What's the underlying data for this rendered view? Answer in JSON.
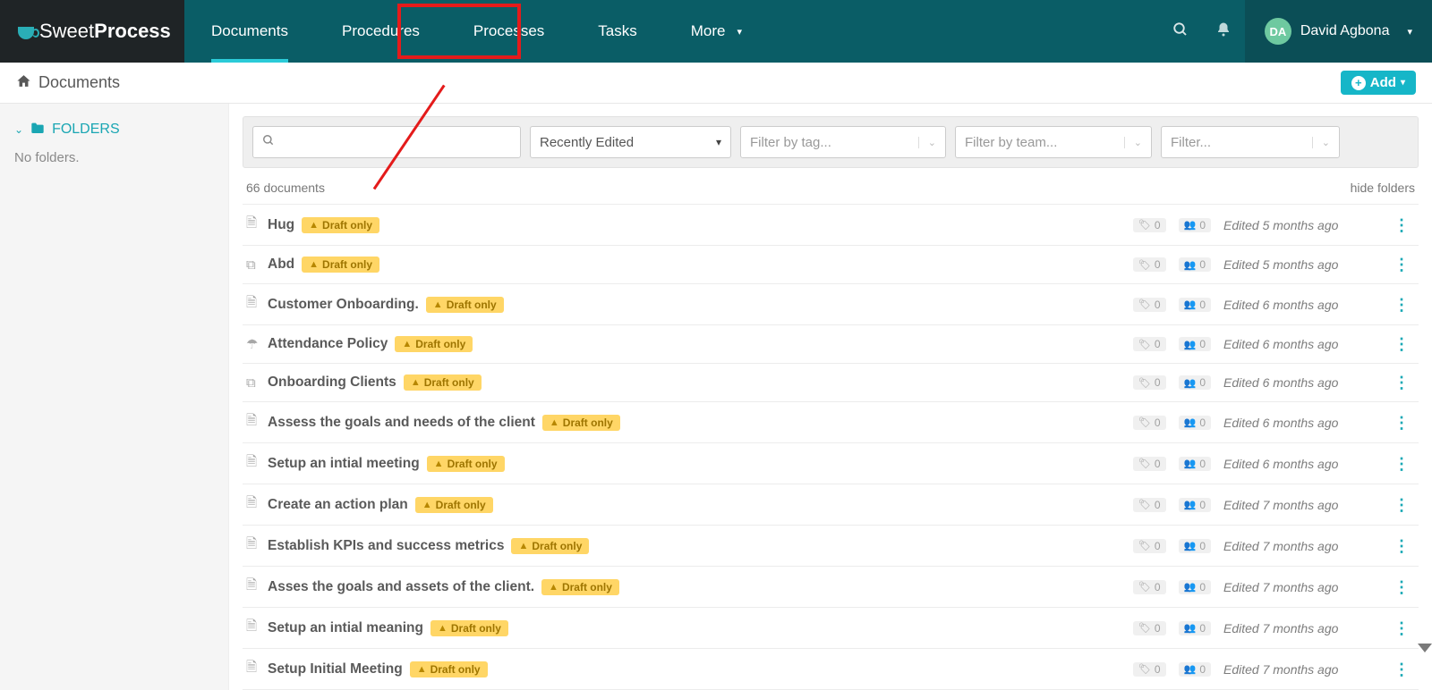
{
  "brand": {
    "first": "Sweet",
    "second": "Process"
  },
  "nav": {
    "documents": "Documents",
    "procedures": "Procedures",
    "processes": "Processes",
    "tasks": "Tasks",
    "more": "More"
  },
  "user": {
    "initials": "DA",
    "name": "David Agbona"
  },
  "subheader": {
    "title": "Documents",
    "add_label": "Add"
  },
  "sidebar": {
    "folders_label": "FOLDERS",
    "empty": "No folders."
  },
  "filters": {
    "sort": "Recently Edited",
    "tag_placeholder": "Filter by tag...",
    "team_placeholder": "Filter by team...",
    "other_placeholder": "Filter..."
  },
  "list": {
    "count_label": "66 documents",
    "hide_label": "hide folders",
    "draft_label": "Draft only",
    "rows": [
      {
        "icon": "doc",
        "title": "Hug",
        "tags": 0,
        "people": 0,
        "edited": "Edited 5 months ago"
      },
      {
        "icon": "copy",
        "title": "Abd",
        "tags": 0,
        "people": 0,
        "edited": "Edited 5 months ago"
      },
      {
        "icon": "doc",
        "title": "Customer Onboarding.",
        "tags": 0,
        "people": 0,
        "edited": "Edited 6 months ago"
      },
      {
        "icon": "umbrella",
        "title": "Attendance Policy",
        "tags": 0,
        "people": 0,
        "edited": "Edited 6 months ago"
      },
      {
        "icon": "copy",
        "title": "Onboarding Clients",
        "tags": 0,
        "people": 0,
        "edited": "Edited 6 months ago"
      },
      {
        "icon": "doc",
        "title": "Assess the goals and needs of the client",
        "tags": 0,
        "people": 0,
        "edited": "Edited 6 months ago"
      },
      {
        "icon": "doc",
        "title": "Setup an intial meeting",
        "tags": 0,
        "people": 0,
        "edited": "Edited 6 months ago"
      },
      {
        "icon": "doc",
        "title": "Create an action plan",
        "tags": 0,
        "people": 0,
        "edited": "Edited 7 months ago"
      },
      {
        "icon": "doc",
        "title": "Establish KPIs and success metrics",
        "tags": 0,
        "people": 0,
        "edited": "Edited 7 months ago"
      },
      {
        "icon": "doc",
        "title": "Asses the goals and assets of the client.",
        "tags": 0,
        "people": 0,
        "edited": "Edited 7 months ago"
      },
      {
        "icon": "doc",
        "title": "Setup an intial meaning",
        "tags": 0,
        "people": 0,
        "edited": "Edited 7 months ago"
      },
      {
        "icon": "doc",
        "title": "Setup Initial Meeting",
        "tags": 0,
        "people": 0,
        "edited": "Edited 7 months ago"
      }
    ]
  },
  "icons": {
    "doc": "🗎",
    "copy": "⧉",
    "umbrella": "☂",
    "tag": "🏷",
    "people": "👥",
    "warn": "▲"
  }
}
